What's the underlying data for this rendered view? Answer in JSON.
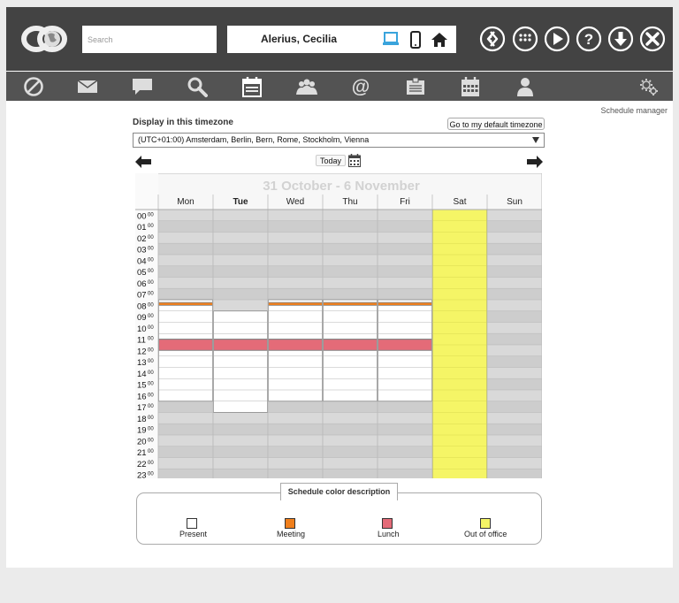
{
  "header": {
    "search_placeholder": "Search",
    "user_name": "Alerius, Cecilia"
  },
  "top_buttons": [
    "back-icon",
    "apps-grid-icon",
    "play-icon",
    "help-icon",
    "download-icon",
    "close-icon"
  ],
  "nav_icons": [
    "blocked-icon",
    "mail-icon",
    "chat-icon",
    "search-icon",
    "schedule-icon",
    "group-icon",
    "at-sign-icon",
    "id-card-icon",
    "calendar-icon",
    "person-icon",
    "gears-icon"
  ],
  "schedule_manager_label": "Schedule manager",
  "timezone": {
    "label": "Display in this timezone",
    "default_button": "Go to my default timezone",
    "selected": "(UTC+01:00) Amsterdam, Berlin, Bern, Rome, Stockholm, Vienna"
  },
  "week_nav": {
    "today_label": "Today"
  },
  "schedule": {
    "title": "31 October - 6 November",
    "days": [
      "Mon",
      "Tue",
      "Wed",
      "Thu",
      "Fri",
      "Sat",
      "Sun"
    ],
    "current_day_index": 1,
    "hours": [
      "00",
      "01",
      "02",
      "03",
      "04",
      "05",
      "06",
      "07",
      "08",
      "09",
      "10",
      "11",
      "12",
      "13",
      "14",
      "15",
      "16",
      "17",
      "18",
      "19",
      "20",
      "21",
      "22",
      "23"
    ],
    "minutes_label": "00",
    "blocks": [
      {
        "day": 0,
        "start": 8.0,
        "end": 8.25,
        "type": "present"
      },
      {
        "day": 0,
        "start": 8.25,
        "end": 8.5,
        "type": "meeting"
      },
      {
        "day": 0,
        "start": 8.5,
        "end": 11.5,
        "type": "present"
      },
      {
        "day": 0,
        "start": 11.5,
        "end": 12.5,
        "type": "lunch"
      },
      {
        "day": 0,
        "start": 12.5,
        "end": 17.0,
        "type": "present"
      },
      {
        "day": 1,
        "start": 9.0,
        "end": 11.5,
        "type": "present"
      },
      {
        "day": 1,
        "start": 11.5,
        "end": 12.5,
        "type": "lunch"
      },
      {
        "day": 1,
        "start": 12.5,
        "end": 18.0,
        "type": "present"
      },
      {
        "day": 2,
        "start": 8.0,
        "end": 8.25,
        "type": "present"
      },
      {
        "day": 2,
        "start": 8.25,
        "end": 8.5,
        "type": "meeting"
      },
      {
        "day": 2,
        "start": 8.5,
        "end": 11.5,
        "type": "present"
      },
      {
        "day": 2,
        "start": 11.5,
        "end": 12.5,
        "type": "lunch"
      },
      {
        "day": 2,
        "start": 12.5,
        "end": 17.0,
        "type": "present"
      },
      {
        "day": 3,
        "start": 8.0,
        "end": 8.25,
        "type": "present"
      },
      {
        "day": 3,
        "start": 8.25,
        "end": 8.5,
        "type": "meeting"
      },
      {
        "day": 3,
        "start": 8.5,
        "end": 11.5,
        "type": "present"
      },
      {
        "day": 3,
        "start": 11.5,
        "end": 12.5,
        "type": "lunch"
      },
      {
        "day": 3,
        "start": 12.5,
        "end": 17.0,
        "type": "present"
      },
      {
        "day": 4,
        "start": 8.0,
        "end": 8.25,
        "type": "present"
      },
      {
        "day": 4,
        "start": 8.25,
        "end": 8.5,
        "type": "meeting"
      },
      {
        "day": 4,
        "start": 8.5,
        "end": 11.5,
        "type": "present"
      },
      {
        "day": 4,
        "start": 11.5,
        "end": 12.5,
        "type": "lunch"
      },
      {
        "day": 4,
        "start": 12.5,
        "end": 17.0,
        "type": "present"
      },
      {
        "day": 5,
        "start": 0.0,
        "end": 24.0,
        "type": "out-of-office"
      }
    ]
  },
  "legend": {
    "title": "Schedule color description",
    "items": [
      {
        "label": "Present",
        "color": "#ffffff"
      },
      {
        "label": "Meeting",
        "color": "#f07f1c"
      },
      {
        "label": "Lunch",
        "color": "#e46b78"
      },
      {
        "label": "Out of office",
        "color": "#f5f566"
      }
    ]
  },
  "colors": {
    "topbar": "#434343",
    "navbar": "#535353",
    "closed": "#cdcdcd",
    "closed_alt": "#d9d9d9",
    "present": "#ffffff",
    "meeting": "#f07f1c",
    "lunch": "#e46b78",
    "out-of-office": "#f5f566",
    "accent_blue": "#3aa4dc"
  }
}
